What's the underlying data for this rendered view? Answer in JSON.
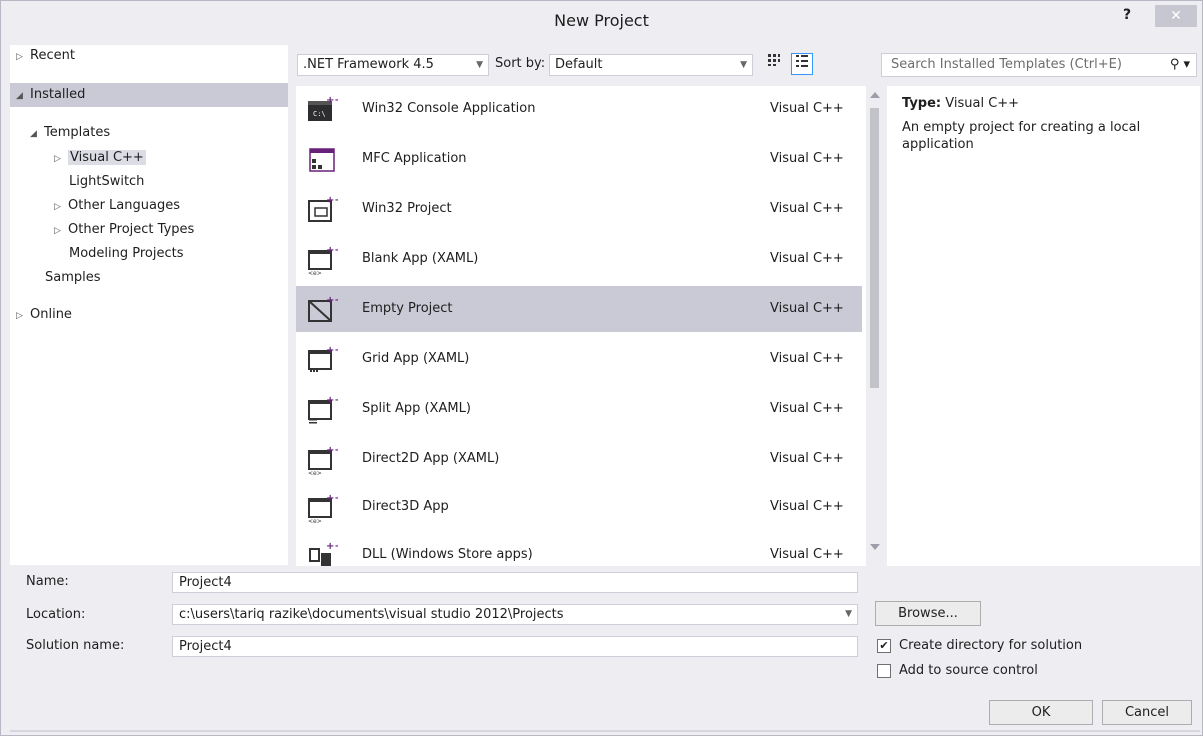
{
  "window": {
    "title": "New Project",
    "help": "?",
    "close": "✕"
  },
  "tree": [
    {
      "label": "Recent",
      "arrow": "▷"
    },
    {
      "label": "Installed",
      "arrow": "◢"
    },
    {
      "label": "Templates",
      "arrow": "◢"
    },
    {
      "label": "Visual C++",
      "arrow": "▷"
    },
    {
      "label": "LightSwitch",
      "arrow": ""
    },
    {
      "label": "Other Languages",
      "arrow": "▷"
    },
    {
      "label": "Other Project Types",
      "arrow": "▷"
    },
    {
      "label": "Modeling Projects",
      "arrow": ""
    },
    {
      "label": "Samples",
      "arrow": ""
    },
    {
      "label": "Online",
      "arrow": "▷"
    }
  ],
  "toolbar": {
    "framework": ".NET Framework 4.5",
    "sort_label": "Sort by:",
    "sort_value": "Default",
    "view_small_icons": "small-icons-view",
    "view_list": "list-view"
  },
  "search": {
    "placeholder": "Search Installed Templates (Ctrl+E)",
    "icon": "search-icon"
  },
  "templates": [
    {
      "name": "Win32 Console Application",
      "lang": "Visual C++"
    },
    {
      "name": "MFC Application",
      "lang": "Visual C++"
    },
    {
      "name": "Win32 Project",
      "lang": "Visual C++"
    },
    {
      "name": "Blank App (XAML)",
      "lang": "Visual C++"
    },
    {
      "name": "Empty Project",
      "lang": "Visual C++"
    },
    {
      "name": "Grid App (XAML)",
      "lang": "Visual C++"
    },
    {
      "name": "Split App (XAML)",
      "lang": "Visual C++"
    },
    {
      "name": "Direct2D App (XAML)",
      "lang": "Visual C++"
    },
    {
      "name": "Direct3D App",
      "lang": "Visual C++"
    },
    {
      "name": "DLL (Windows Store apps)",
      "lang": "Visual C++"
    }
  ],
  "description": {
    "type_label": "Type:",
    "type_value": "Visual C++",
    "text": "An empty project for creating a local application"
  },
  "form": {
    "name_label": "Name:",
    "name_value": "Project4",
    "location_label": "Location:",
    "location_value": "c:\\users\\tariq razike\\documents\\visual studio 2012\\Projects",
    "solution_label": "Solution name:",
    "solution_value": "Project4",
    "browse": "Browse...",
    "create_dir": "Create directory for solution",
    "create_dir_checked": true,
    "source_control": "Add to source control",
    "source_control_checked": false,
    "ok": "OK",
    "cancel": "Cancel"
  },
  "colors": {
    "accent": "#3399ff",
    "selection": "#c9cad6",
    "chrome": "#eeeef2",
    "icon_purple": "#68217a"
  }
}
